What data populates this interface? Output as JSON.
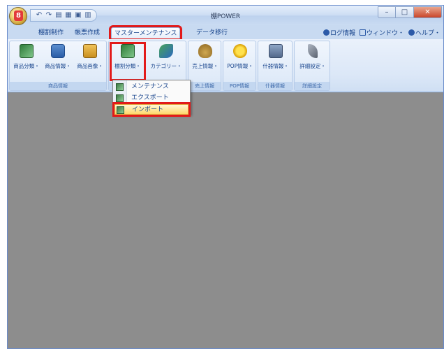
{
  "window": {
    "title": "棚POWER"
  },
  "qat": {
    "icons": [
      "undo-icon",
      "redo-icon",
      "save-icon",
      "icon-a",
      "icon-b",
      "icon-c"
    ]
  },
  "tabs": [
    {
      "label": "棚割制作",
      "active": false
    },
    {
      "label": "帳票作成",
      "active": false
    },
    {
      "label": "マスターメンテナンス",
      "active": true
    },
    {
      "label": "データ移行",
      "active": false
    }
  ],
  "right_menu": {
    "log": "ログ情報",
    "window": "ウィンドウ・",
    "help": "ヘルプ・"
  },
  "ribbon": {
    "groups": [
      {
        "label": "商品情報",
        "buttons": [
          "商品分類・",
          "商品情報・",
          "商品画像・"
        ]
      },
      {
        "label": "",
        "buttons": [
          "棚割分類・",
          "カテゴリー・"
        ]
      },
      {
        "label": "売上情報",
        "buttons": [
          "売上情報・"
        ]
      },
      {
        "label": "POP情報",
        "buttons": [
          "POP情報・"
        ]
      },
      {
        "label": "什器情報",
        "buttons": [
          "什器情報・"
        ]
      },
      {
        "label": "詳細設定",
        "buttons": [
          "詳細設定・"
        ]
      }
    ]
  },
  "dropdown": {
    "items": [
      {
        "label": "メンテナンス"
      },
      {
        "label": "エクスポート"
      },
      {
        "label": "インポート"
      }
    ]
  }
}
